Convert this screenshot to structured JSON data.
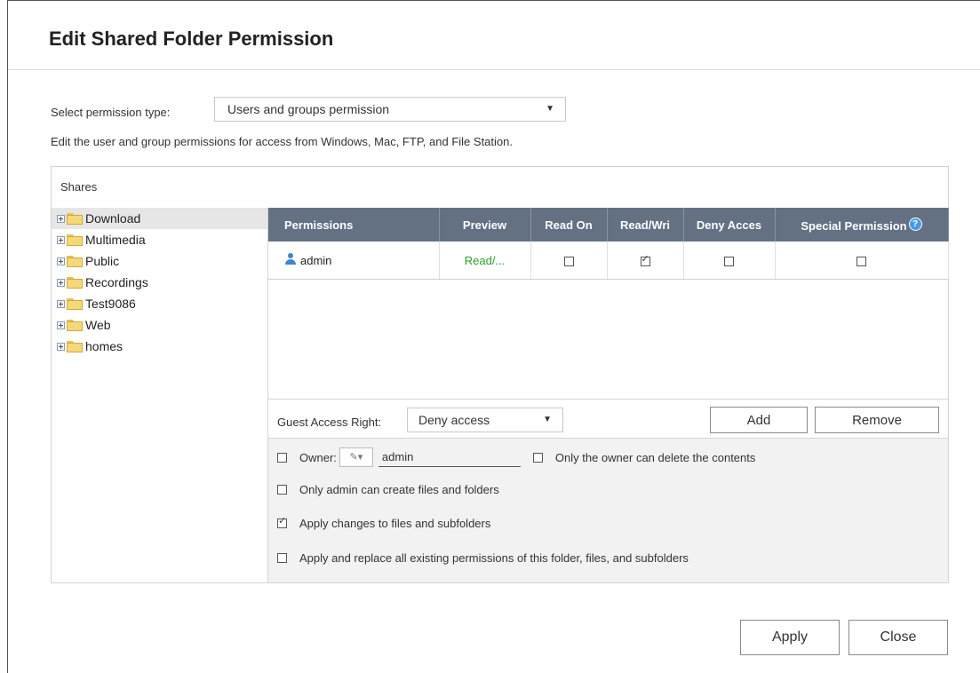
{
  "dialog": {
    "title": "Edit Shared Folder Permission",
    "permission_type_label": "Select permission type:",
    "permission_type_value": "Users and groups permission",
    "description": "Edit the user and group permissions for access from Windows, Mac, FTP, and File Station."
  },
  "shares": {
    "header": "Shares",
    "folders": [
      {
        "name": "Download",
        "selected": true
      },
      {
        "name": "Multimedia"
      },
      {
        "name": "Public"
      },
      {
        "name": "Recordings"
      },
      {
        "name": "Test9086"
      },
      {
        "name": "Web"
      },
      {
        "name": "homes"
      }
    ]
  },
  "permissions_table": {
    "columns": [
      "Permissions",
      "Preview",
      "Read On",
      "Read/Wri",
      "Deny Acces",
      "Special Permission"
    ],
    "rows": [
      {
        "user": "admin",
        "preview": "Read/...",
        "read_only": false,
        "read_write": true,
        "deny": false,
        "special": false
      }
    ]
  },
  "guest": {
    "label": "Guest Access Right:",
    "value": "Deny access",
    "add_label": "Add",
    "remove_label": "Remove"
  },
  "options": {
    "owner_label": "Owner:",
    "owner_value": "admin",
    "only_owner_delete": "Only the owner can delete the contents",
    "only_admin_create": "Only admin can create files and folders",
    "apply_changes": "Apply changes to files and subfolders",
    "apply_replace": "Apply and replace all existing permissions of this folder, files, and subfolders"
  },
  "footer": {
    "apply_label": "Apply",
    "close_label": "Close"
  },
  "colors": {
    "table_header": "#647183",
    "preview_text": "#2aa12a",
    "user_icon": "#3b86d3"
  }
}
